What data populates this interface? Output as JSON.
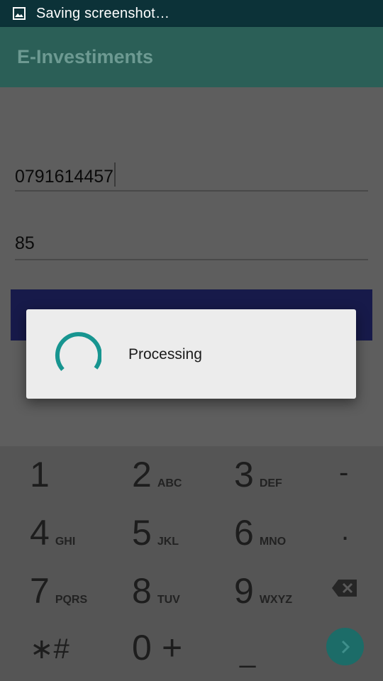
{
  "status_bar": {
    "icon": "image-icon",
    "text": "Saving screenshot…"
  },
  "app_bar": {
    "title": "E-Investiments"
  },
  "form": {
    "phone_value": "0791614457",
    "amount_value": "85"
  },
  "dialog": {
    "message": "Processing",
    "spinner_icon": "progress-spinner",
    "accent_color": "#179590"
  },
  "keypad": {
    "keys": [
      {
        "num": "1",
        "letters": ""
      },
      {
        "num": "2",
        "letters": "ABC"
      },
      {
        "num": "3",
        "letters": "DEF"
      },
      {
        "num": "-",
        "letters": ""
      },
      {
        "num": "4",
        "letters": "GHI"
      },
      {
        "num": "5",
        "letters": "JKL"
      },
      {
        "num": "6",
        "letters": "MNO"
      },
      {
        "num": ".",
        "letters": ""
      },
      {
        "num": "7",
        "letters": "PQRS"
      },
      {
        "num": "8",
        "letters": "TUV"
      },
      {
        "num": "9",
        "letters": "WXYZ"
      },
      {
        "num": "∗#",
        "letters": ""
      },
      {
        "num": "0",
        "letters": ""
      },
      {
        "num": "+",
        "letters": ""
      },
      {
        "num": "_",
        "letters": ""
      }
    ],
    "backspace_icon": "backspace-icon",
    "enter_icon": "chevron-right-icon"
  },
  "colors": {
    "status_bar": "#0c3238",
    "app_bar": "#2b5f57",
    "submit_button": "#171a4a",
    "enter_button": "#1c6c68"
  }
}
